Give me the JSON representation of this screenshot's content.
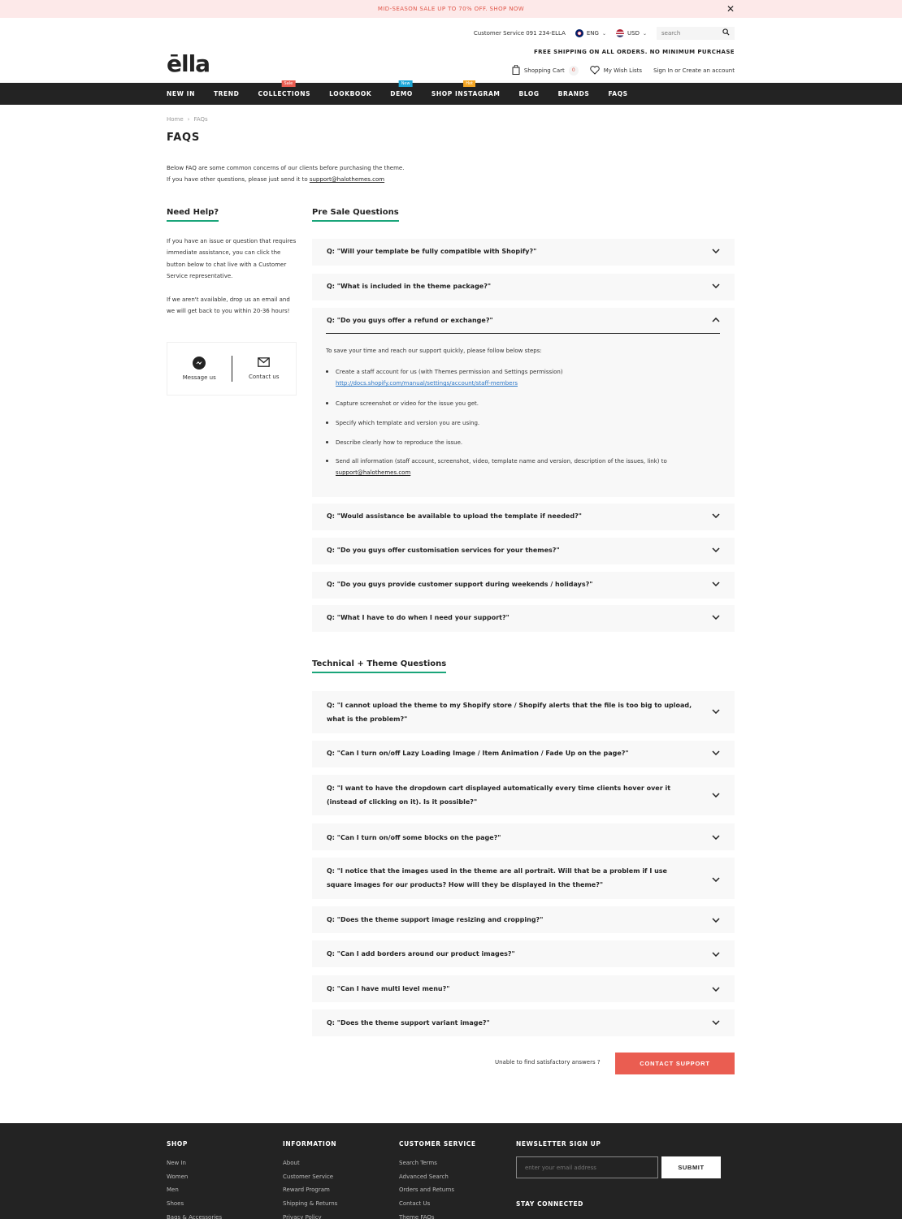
{
  "announcement": {
    "text": "MID-SEASON SALE UP TO 70% OFF. SHOP NOW",
    "close": "✕"
  },
  "header": {
    "customer_service": "Customer Service 091 234-ELLA",
    "language": "ENG",
    "currency": "USD",
    "search_placeholder": "search",
    "logo": "ēlla",
    "shipping": "FREE SHIPPING ON ALL ORDERS. NO MINIMUM PURCHASE",
    "cart_label": "Shopping Cart",
    "cart_count": "0",
    "wishlist": "My Wish Lists",
    "account": "Sign In or Create an account"
  },
  "nav": [
    {
      "label": "NEW IN"
    },
    {
      "label": "TREND"
    },
    {
      "label": "COLLECTIONS",
      "badge": "Sale",
      "badge_color": "#ea5d51"
    },
    {
      "label": "LOOKBOOK"
    },
    {
      "label": "DEMO",
      "badge": "New",
      "badge_color": "#1ca6d6"
    },
    {
      "label": "SHOP INSTAGRAM",
      "badge": "Hot",
      "badge_color": "#f5a623"
    },
    {
      "label": "BLOG"
    },
    {
      "label": "BRANDS"
    },
    {
      "label": "FAQS"
    }
  ],
  "breadcrumb": {
    "home": "Home",
    "sep": "›",
    "current": "FAQs"
  },
  "page": {
    "title": "FAQS",
    "intro_1": "Below FAQ are some common concerns of our clients before purchasing the theme.",
    "intro_2": "If you have other questions, please just send it to ",
    "intro_email": "support@halothemes.com"
  },
  "help": {
    "title": "Need Help?",
    "p1": "If you have an issue or question that requires immediate assistance, you can click the button below to chat live with a Customer Service representative.",
    "p2": "If we aren't available, drop us an email and we will get back to you within 20-36 hours!",
    "message": "Message us",
    "contact": "Contact us"
  },
  "pre_sale": {
    "title": "Pre Sale Questions",
    "items": [
      "Q: \"Will your template be fully compatible with Shopify?\"",
      "Q: \"What is included in the theme package?\"",
      "Q: \"Do you guys offer a refund or exchange?\"",
      "Q: \"Would assistance be available to upload the template if needed?\"",
      "Q: \"Do you guys offer customisation services for your themes?\"",
      "Q: \"Do you guys provide customer support during weekends / holidays?\"",
      "Q: \"What I have to do when I need your support?\""
    ],
    "answer_intro": "To save your time and reach our support quickly, please follow below steps:",
    "answer_steps": [
      "Create a staff account for us (with Themes permission and Settings permission)",
      "Capture screenshot or video for the issue you get.",
      "Specify which template and version you are using.",
      "Describe clearly how to reproduce the issue.",
      "Send all information (staff account, screenshot, video, template name and version, description of the issues, link) to"
    ],
    "answer_link": "http://docs.shopify.com/manual/settings/account/staff-members",
    "answer_email": "support@halothemes.com"
  },
  "technical": {
    "title": "Technical + Theme Questions",
    "items": [
      "Q: \"I cannot upload the theme to my Shopify store / Shopify alerts that the file is too big to upload, what is the problem?\"",
      "Q: \"Can I turn on/off Lazy Loading Image / Item Animation / Fade Up on the page?\"",
      "Q: \"I want to have the dropdown cart displayed automatically every time clients hover over it (instead of clicking on it). Is it possible?\"",
      "Q: \"Can I turn on/off some blocks on the page?\"",
      "Q: \"I notice that the images used in the theme are all portrait. Will that be a problem if I use square images for our products? How will they be displayed in the theme?\"",
      "Q: \"Does the theme support image resizing and cropping?\"",
      "Q: \"Can I add borders around our product images?\"",
      "Q: \"Can I have multi level menu?\"",
      "Q: \"Does the theme support variant image?\""
    ]
  },
  "support": {
    "text": "Unable to find satisfactory answers ?",
    "button": "CONTACT SUPPORT"
  },
  "footer": {
    "shop": {
      "title": "SHOP",
      "links": [
        "New In",
        "Women",
        "Men",
        "Shoes",
        "Bags & Accessories"
      ]
    },
    "information": {
      "title": "INFORMATION",
      "links": [
        "About",
        "Customer Service",
        "Reward Program",
        "Shipping & Returns",
        "Privacy Policy"
      ]
    },
    "customer_service": {
      "title": "CUSTOMER SERVICE",
      "links": [
        "Search Terms",
        "Advanced Search",
        "Orders and Returns",
        "Contact Us",
        "Theme FAQs"
      ]
    },
    "newsletter": {
      "title": "NEWSLETTER SIGN UP",
      "placeholder": "enter your email address",
      "button": "SUBMIT",
      "stay": "STAY CONNECTED"
    }
  },
  "icons": {
    "chevron_down": "chevron-down-icon",
    "chevron_up": "chevron-up-icon",
    "cart": "bag-icon",
    "wishlist": "heart-icon",
    "search": "search-icon"
  }
}
